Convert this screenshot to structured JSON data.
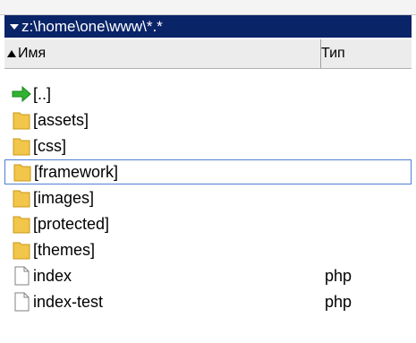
{
  "path": "z:\\home\\one\\www\\*.*",
  "columns": {
    "name": "Имя",
    "type": "Тип"
  },
  "files": [
    {
      "name": "[..]",
      "ext": "",
      "icon": "up-arrow-icon"
    },
    {
      "name": "[assets]",
      "ext": "",
      "icon": "folder-icon"
    },
    {
      "name": "[css]",
      "ext": "",
      "icon": "folder-icon"
    },
    {
      "name": "[framework]",
      "ext": "",
      "icon": "folder-icon",
      "selected": true
    },
    {
      "name": "[images]",
      "ext": "",
      "icon": "folder-icon"
    },
    {
      "name": "[protected]",
      "ext": "",
      "icon": "folder-icon"
    },
    {
      "name": "[themes]",
      "ext": "",
      "icon": "folder-icon"
    },
    {
      "name": "index",
      "ext": "php",
      "icon": "file-icon"
    },
    {
      "name": "index-test",
      "ext": "php",
      "icon": "file-icon"
    }
  ],
  "colors": {
    "path_bar": "#0a2468",
    "selection_border": "#4f7fd3",
    "folder": "#f2c54b",
    "up_arrow": "#33b233"
  }
}
